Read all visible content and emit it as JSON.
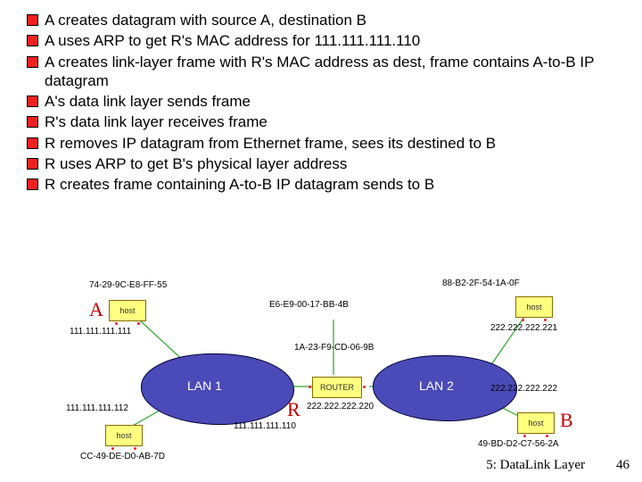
{
  "bullets": [
    "A creates datagram with source A, destination B",
    "A uses ARP to get R's MAC address for 111.111.111.110",
    "A creates link-layer frame with R's MAC address as dest, frame contains A-to-B IP datagram",
    "A's data link layer sends frame",
    "R's data link layer receives frame",
    "R removes IP datagram from Ethernet frame, sees its destined to B",
    "R uses ARP to get B's physical layer address",
    "R creates frame containing A-to-B IP datagram sends to B"
  ],
  "diagram": {
    "lan1_label": "LAN 1",
    "lan2_label": "LAN 2",
    "host_word": "host",
    "router_word": "ROUTER",
    "letter_A": "A",
    "letter_R": "R",
    "letter_B": "B",
    "macs": {
      "a_mac": "74-29-9C-E8-FF-55",
      "router_left_mac": "E6-E9-00-17-BB-4B",
      "router_right_mac": "1A-23-F9-CD-06-9B",
      "b_top_mac": "88-B2-2F-54-1A-0F",
      "b_mac": "49-BD-D2-C7-56-2A",
      "a2_mac": "CC-49-DE-D0-AB-7D"
    },
    "ips": {
      "a_ip": "111.111.111.111",
      "a2_ip": "111.111.111.112",
      "router_left_ip": "111.111.111.110",
      "router_right_ip": "222.222.222.220",
      "b_top_ip": "222.222.222.221",
      "b_ip": "222.222.222.222"
    }
  },
  "footer": {
    "chapter": "5: DataLink Layer",
    "page": "46"
  }
}
